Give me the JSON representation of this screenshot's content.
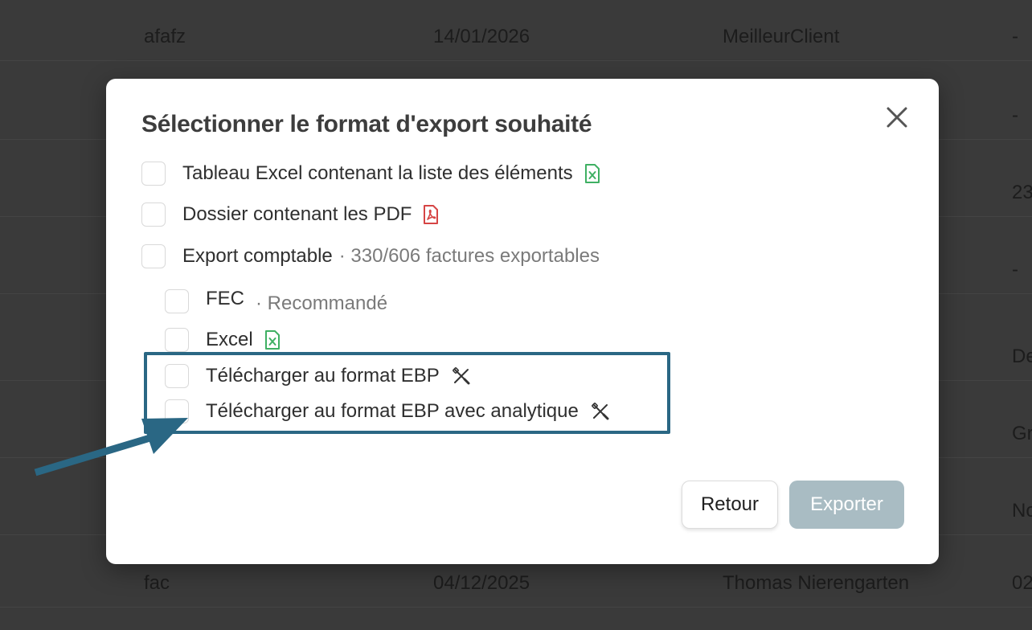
{
  "background_table": {
    "rows": [
      {
        "c1": "afafz",
        "c2": "14/01/2026",
        "c3": "MeilleurClient",
        "c4": "-"
      },
      {
        "c1": "",
        "c2": "",
        "c3": "",
        "c4": "-"
      },
      {
        "c1": "",
        "c2": "",
        "c3": "",
        "c4": "23"
      },
      {
        "c1": "",
        "c2": "",
        "c3": "",
        "c4": "-"
      },
      {
        "c1": "",
        "c2": "",
        "c3": "",
        "c4": "De"
      },
      {
        "c1": "",
        "c2": "",
        "c3": "",
        "c4": "Gr"
      },
      {
        "c1": "",
        "c2": "",
        "c3": "",
        "c4": "No"
      },
      {
        "c1": "",
        "c2": "",
        "c3": "",
        "c4": ""
      },
      {
        "c1": "fac",
        "c2": "04/12/2025",
        "c3": "Thomas Nierengarten",
        "c4": "02"
      }
    ]
  },
  "modal": {
    "title": "Sélectionner le format d'export souhaité",
    "close_icon": "close-icon",
    "options": {
      "excel_list": {
        "label": "Tableau Excel contenant la liste des éléments",
        "icon": "excel-file-icon",
        "checked": false
      },
      "pdf_folder": {
        "label": "Dossier contenant les PDF",
        "icon": "pdf-file-icon",
        "checked": false
      },
      "accounting": {
        "label": "Export comptable",
        "meta": "· 330/606 factures exportables",
        "checked": false
      },
      "fec": {
        "label": "FEC",
        "meta": "· Recommandé",
        "checked": false
      },
      "excel": {
        "label": "Excel",
        "icon": "excel-file-icon",
        "checked": false
      },
      "ebp": {
        "label": "Télécharger au format EBP",
        "icon": "tools-icon",
        "checked": false
      },
      "ebp_analytic": {
        "label": "Télécharger au format EBP avec analytique",
        "icon": "tools-icon",
        "checked": false
      }
    },
    "buttons": {
      "back": "Retour",
      "export": "Exporter"
    }
  },
  "colors": {
    "highlight": "#2a6784",
    "excel_green": "#3fb063",
    "pdf_red": "#d64545",
    "export_disabled": "#a9bcc3"
  }
}
